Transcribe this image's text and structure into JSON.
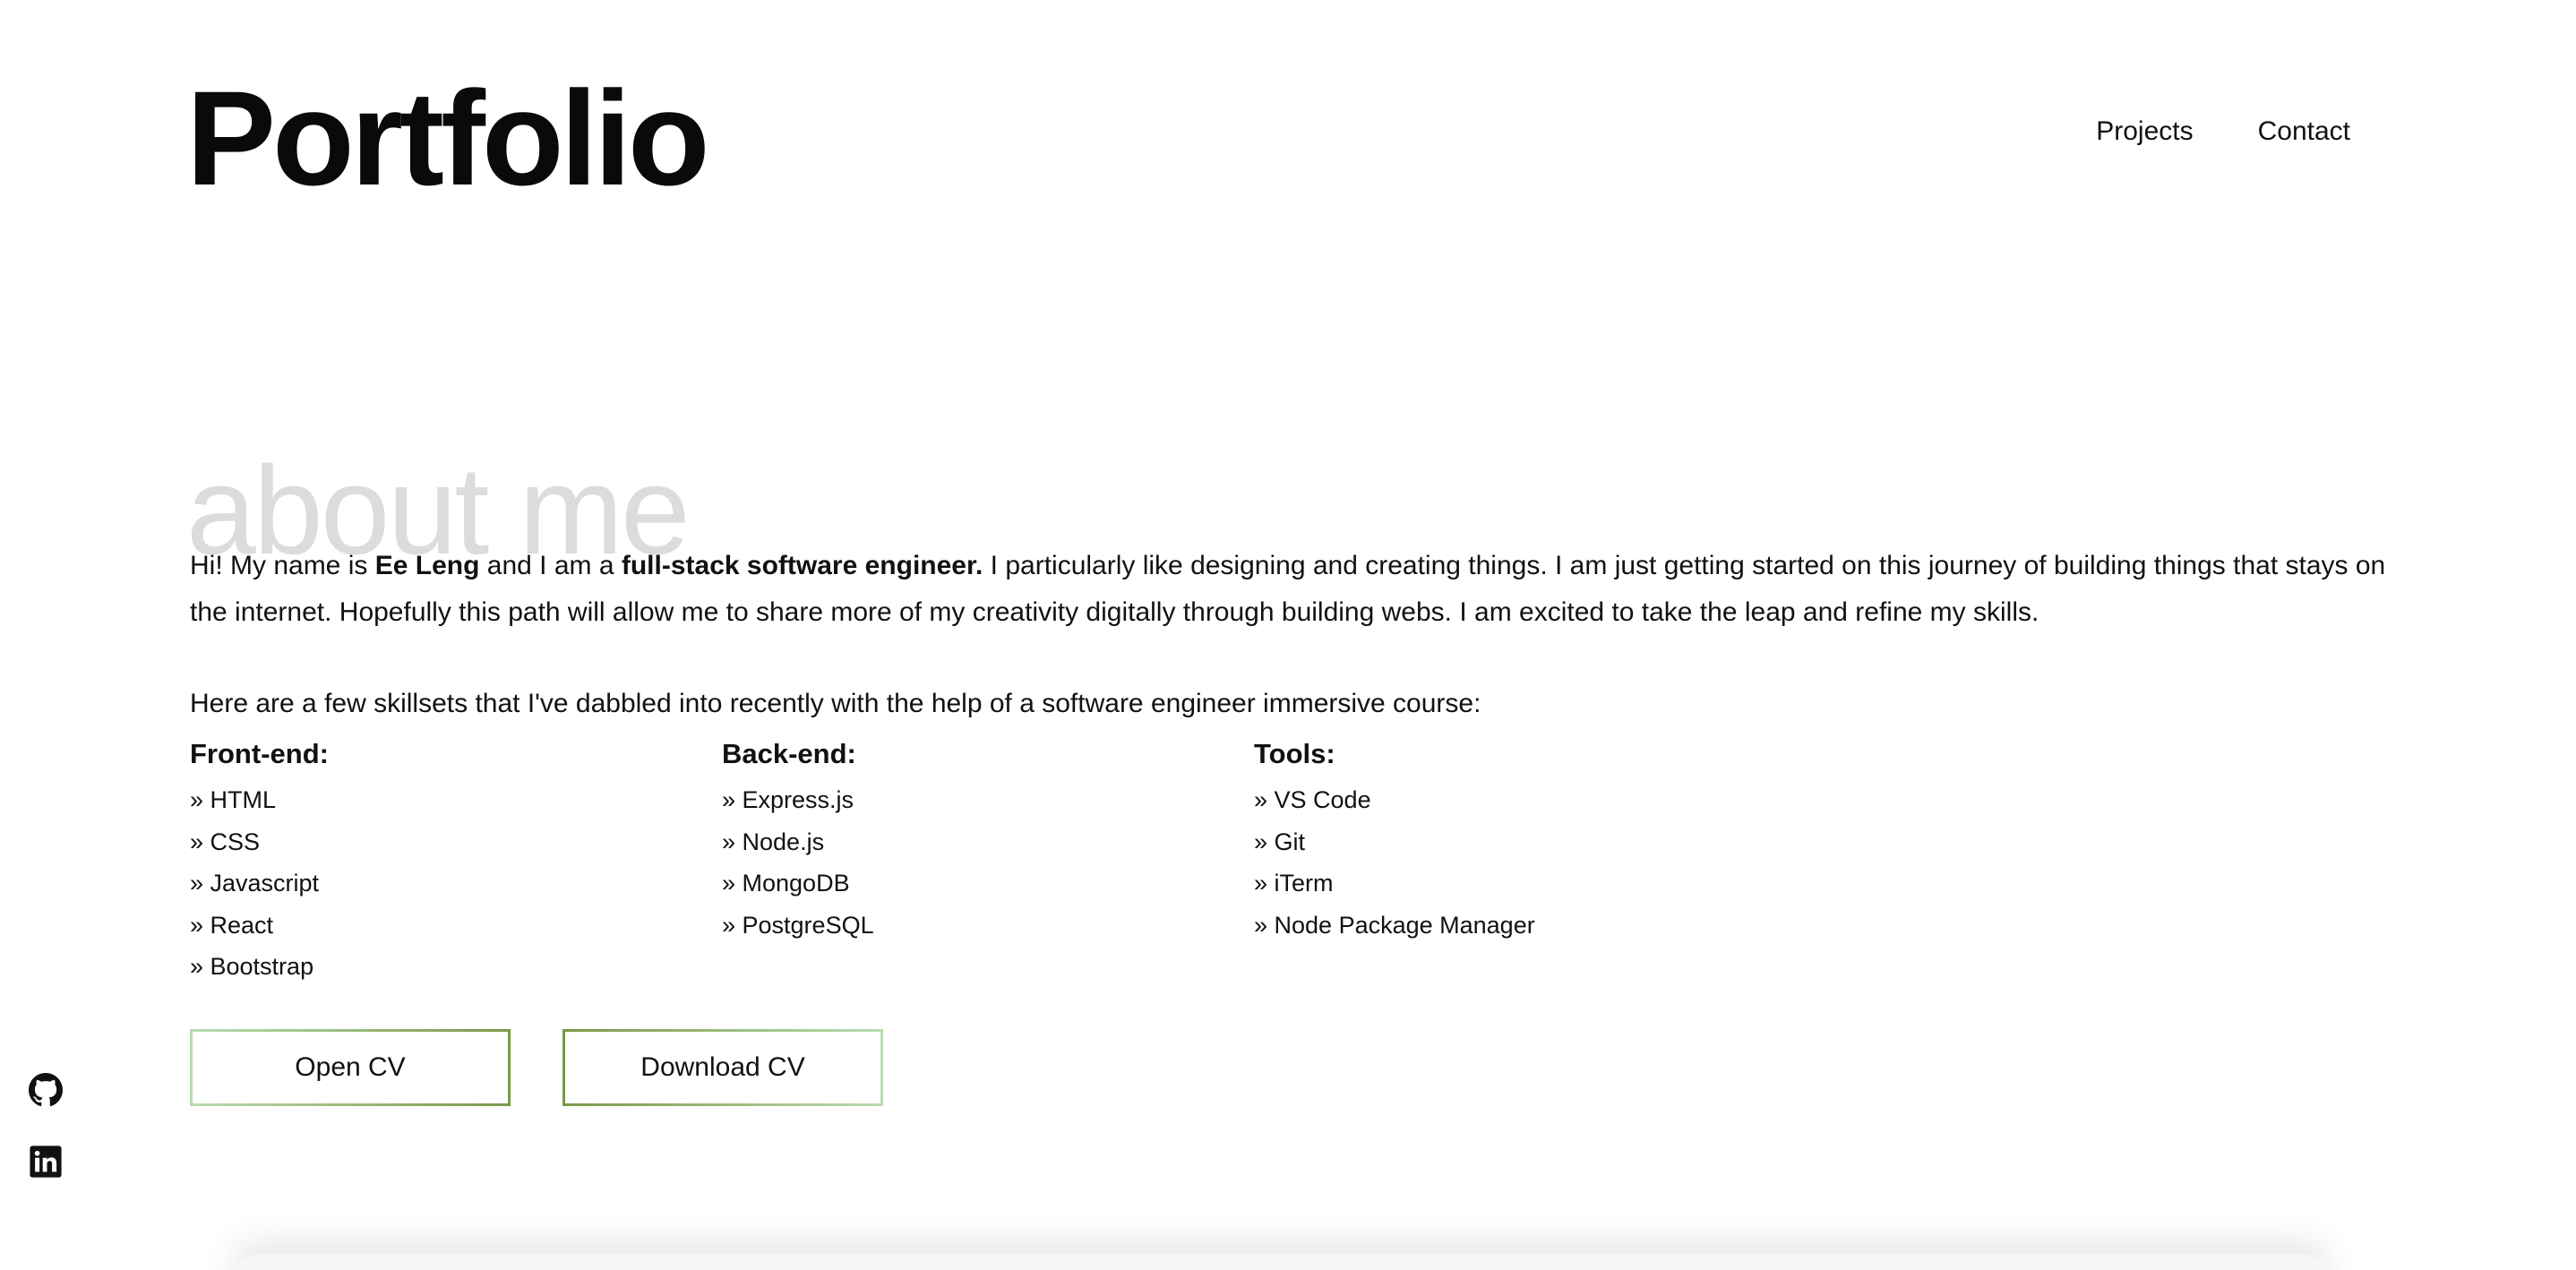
{
  "header": {
    "title": "Portfolio",
    "nav": [
      {
        "label": "Projects"
      },
      {
        "label": "Contact"
      }
    ]
  },
  "about": {
    "heading": "about me",
    "intro": {
      "t1": "Hi! My name is ",
      "name": "Ee Leng",
      "t2": " and I am a ",
      "role": "full-stack software engineer.",
      "t3": " I particularly like designing and creating things. I am just getting started on this journey of building things that stays on the internet. Hopefully this path will allow me to share more of my creativity digitally through building webs. I am excited to take the leap and refine my skills."
    },
    "skills_intro": "Here are a few skillsets that I've dabbled into recently with the help of a software engineer immersive course:",
    "skills": [
      {
        "title": "Front-end:",
        "items": [
          "» HTML",
          "» CSS",
          "» Javascript",
          "» React",
          "» Bootstrap"
        ]
      },
      {
        "title": "Back-end:",
        "items": [
          "» Express.js",
          "» Node.js",
          "» MongoDB",
          "» PostgreSQL"
        ]
      },
      {
        "title": "Tools:",
        "items": [
          "» VS Code",
          "» Git",
          "» iTerm",
          "» Node Package Manager"
        ]
      }
    ],
    "buttons": {
      "open_cv": "Open CV",
      "download_cv": "Download CV"
    }
  },
  "social": {
    "github_icon": "github-icon",
    "linkedin_icon": "linkedin-icon"
  },
  "colors": {
    "button_border_light": "#b9dbb0",
    "button_border_dark": "#7a9a47",
    "heading_watermark": "#dcdcdc"
  }
}
